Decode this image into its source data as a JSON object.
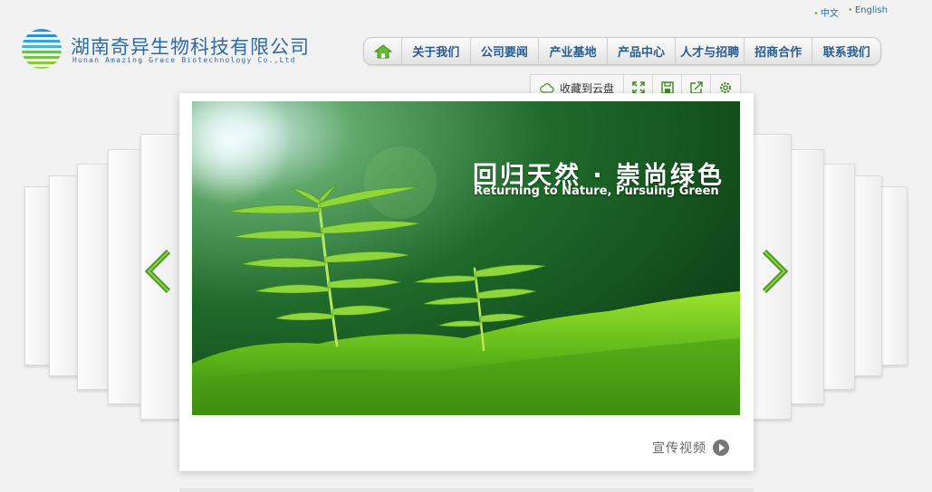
{
  "header": {
    "lang_cn": "中文",
    "lang_en": "English",
    "logo_cn": "湖南奇异生物科技有限公司",
    "logo_en": "Hunan Amazing Grace Biotechnology Co.,Ltd"
  },
  "nav": {
    "home_icon": "home-icon",
    "items": [
      {
        "label": "关于我们"
      },
      {
        "label": "公司要闻"
      },
      {
        "label": "产业基地"
      },
      {
        "label": "产品中心"
      },
      {
        "label": "人才与招聘"
      },
      {
        "label": "招商合作"
      },
      {
        "label": "联系我们"
      }
    ]
  },
  "toolbar": {
    "cloud_label": "收藏到云盘",
    "icons": [
      "cloud-icon",
      "expand-icon",
      "save-icon",
      "share-icon",
      "settings-icon"
    ]
  },
  "banner": {
    "title_cn": "回归天然 · 崇尚绿色",
    "title_en": "Returning to Nature, Pursuing Green"
  },
  "video": {
    "label": "宣传视频"
  },
  "colors": {
    "brand_blue": "#2f6aa5",
    "nav_text": "#2a5d8f",
    "accent_green": "#5fae2e"
  }
}
